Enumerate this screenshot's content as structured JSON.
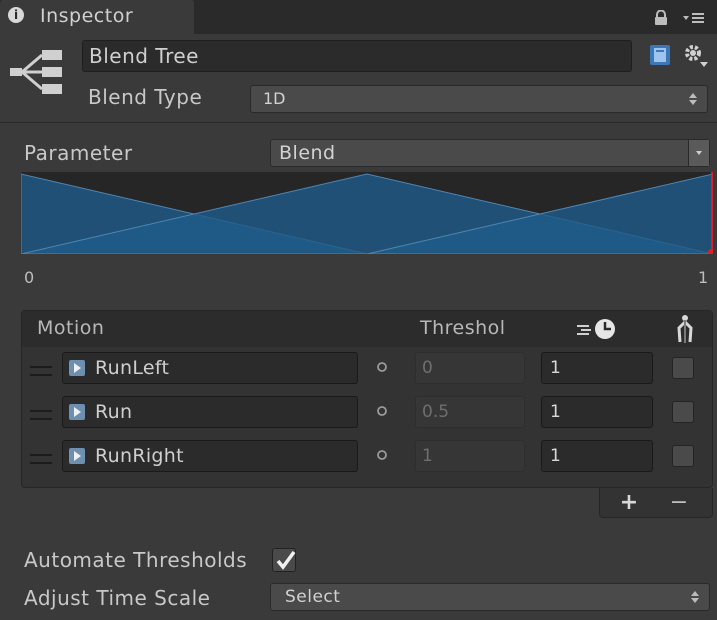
{
  "window": {
    "tab_title": "Inspector",
    "tab_icon": "info-icon"
  },
  "header": {
    "name": "Blend Tree",
    "blend_type_label": "Blend Type",
    "blend_type_value": "1D"
  },
  "parameter": {
    "label": "Parameter",
    "value": "Blend"
  },
  "graph": {
    "min_label": "0",
    "max_label": "1",
    "thresholds": [
      0,
      0.5,
      1
    ],
    "fill_color": "#1f5b8a",
    "marker_color": "#e02020"
  },
  "motion_list": {
    "col_motion": "Motion",
    "col_threshold": "Threshol",
    "col_speed_icon": "speed-clock-icon",
    "col_mirror_icon": "mirror-figure-icon",
    "rows": [
      {
        "clip": "RunLeft",
        "threshold": "0",
        "speed": "1",
        "mirror": false
      },
      {
        "clip": "Run",
        "threshold": "0.5",
        "speed": "1",
        "mirror": false
      },
      {
        "clip": "RunRight",
        "threshold": "1",
        "speed": "1",
        "mirror": false
      }
    ],
    "add_label": "+",
    "remove_label": "−"
  },
  "automate": {
    "label": "Automate Thresholds",
    "checked": true
  },
  "time_scale": {
    "label": "Adjust Time Scale",
    "value": "Select"
  },
  "colors": {
    "panel_bg": "#3a3a3a",
    "field_bg": "#2b2b2b",
    "accent_blue": "#1f5b8a"
  }
}
